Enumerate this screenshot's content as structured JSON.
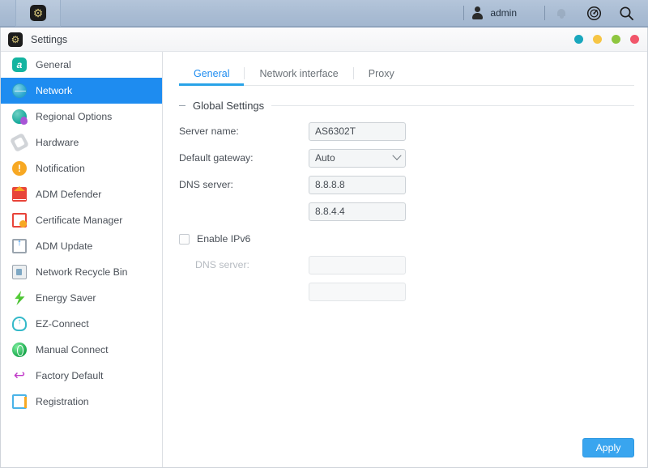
{
  "taskbar": {
    "app_launcher_icon": "gear-icon",
    "user_icon": "user-silhouette-icon",
    "username": "admin",
    "icons": [
      {
        "name": "notification-bell-icon",
        "glyph": "bell"
      },
      {
        "name": "dashboard-icon",
        "glyph": "dashboard"
      },
      {
        "name": "search-icon",
        "glyph": "search"
      }
    ]
  },
  "window": {
    "icon": "gear-icon",
    "title": "Settings",
    "controls": [
      {
        "name": "window-control-info",
        "color": "#19a7bd"
      },
      {
        "name": "window-control-minimize",
        "color": "#f6c councils"
      },
      {
        "name": "window-control-maximize",
        "color": "#8ec63f"
      },
      {
        "name": "window-control-close",
        "color": "#f1566a"
      }
    ]
  },
  "sidebar": {
    "items": [
      {
        "label": "General",
        "icon": "general-icon",
        "icon_class": "ic-general",
        "glyph": "a",
        "active": false
      },
      {
        "label": "Network",
        "icon": "network-globe-icon",
        "icon_class": "ic-globe",
        "glyph": "",
        "active": true
      },
      {
        "label": "Regional Options",
        "icon": "regional-options-icon",
        "icon_class": "ic-region",
        "glyph": "",
        "active": false
      },
      {
        "label": "Hardware",
        "icon": "hardware-icon",
        "icon_class": "ic-hw",
        "glyph": "",
        "active": false
      },
      {
        "label": "Notification",
        "icon": "notification-icon",
        "icon_class": "ic-notif",
        "glyph": "!",
        "active": false
      },
      {
        "label": "ADM Defender",
        "icon": "adm-defender-icon",
        "icon_class": "ic-defender",
        "glyph": "",
        "active": false
      },
      {
        "label": "Certificate Manager",
        "icon": "certificate-manager-icon",
        "icon_class": "ic-cert",
        "glyph": "",
        "active": false
      },
      {
        "label": "ADM Update",
        "icon": "adm-update-icon",
        "icon_class": "ic-update",
        "glyph": "",
        "active": false
      },
      {
        "label": "Network Recycle Bin",
        "icon": "network-recycle-bin-icon",
        "icon_class": "ic-recycle",
        "glyph": "",
        "active": false
      },
      {
        "label": "Energy Saver",
        "icon": "energy-saver-icon",
        "icon_class": "ic-energy",
        "glyph": "",
        "active": false
      },
      {
        "label": "EZ-Connect",
        "icon": "ez-connect-icon",
        "icon_class": "ic-ez",
        "glyph": "",
        "active": false
      },
      {
        "label": "Manual Connect",
        "icon": "manual-connect-icon",
        "icon_class": "ic-manual",
        "glyph": "",
        "active": false
      },
      {
        "label": "Factory Default",
        "icon": "factory-default-icon",
        "icon_class": "ic-factory",
        "glyph": "↩",
        "active": false
      },
      {
        "label": "Registration",
        "icon": "registration-icon",
        "icon_class": "ic-reg",
        "glyph": "",
        "active": false
      }
    ]
  },
  "main": {
    "tabs": [
      {
        "label": "General",
        "active": true
      },
      {
        "label": "Network interface",
        "active": false
      },
      {
        "label": "Proxy",
        "active": false
      }
    ],
    "section_title": "Global Settings",
    "fields": {
      "server_name_label": "Server name:",
      "server_name_value": "AS6302T",
      "default_gateway_label": "Default gateway:",
      "default_gateway_value": "Auto",
      "dns_server_label": "DNS server:",
      "dns_primary_value": "8.8.8.8",
      "dns_secondary_value": "8.8.4.4",
      "enable_ipv6_label": "Enable IPv6",
      "enable_ipv6_checked": false,
      "ipv6_dns_label": "DNS server:",
      "ipv6_dns_primary_value": "",
      "ipv6_dns_secondary_value": ""
    },
    "apply_label": "Apply"
  },
  "colors": {
    "accent_blue": "#1e8cf0",
    "tab_underline": "#29a3e8",
    "apply_button": "#39a5ef",
    "taskbar": "#a9bcd3"
  }
}
